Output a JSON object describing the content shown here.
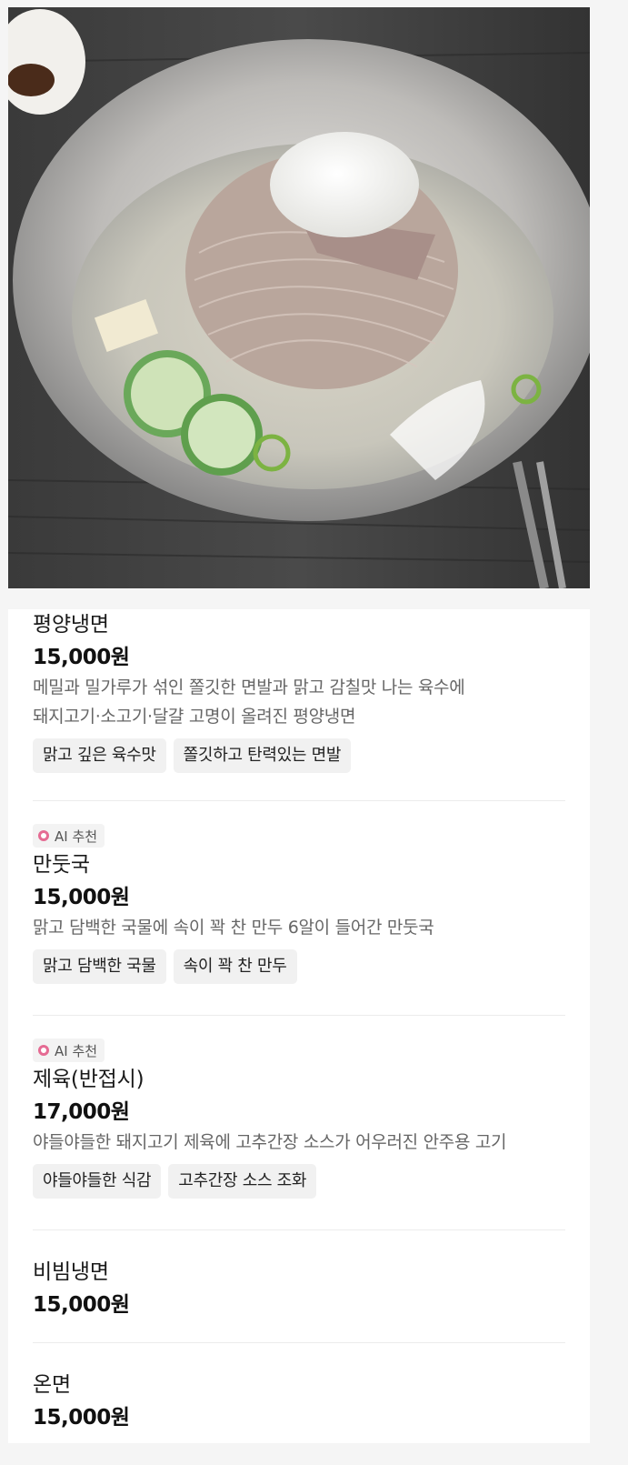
{
  "photo": {
    "subject": "naengmyeon-bowl-photo"
  },
  "badge_label": "AI 추천",
  "menu": [
    {
      "name": "평양냉면",
      "price": "15,000원",
      "desc_lines": [
        "메밀과 밀가루가 섞인 쫄깃한 면발과 맑고 감칠맛 나는 육수에",
        "돼지고기·소고기·달걀 고명이 올려진 평양냉면"
      ],
      "tags": [
        "맑고 깊은 육수맛",
        "쫄깃하고 탄력있는 면발"
      ],
      "ai": false
    },
    {
      "name": "만둣국",
      "price": "15,000원",
      "desc_lines": [
        "맑고 담백한 국물에 속이 꽉 찬 만두 6알이 들어간 만둣국"
      ],
      "tags": [
        "맑고 담백한 국물",
        "속이 꽉 찬 만두"
      ],
      "ai": true
    },
    {
      "name": "제육(반접시)",
      "price": "17,000원",
      "desc_lines": [
        "야들야들한 돼지고기 제육에 고추간장 소스가 어우러진 안주용 고기"
      ],
      "tags": [
        "야들야들한 식감",
        "고추간장 소스 조화"
      ],
      "ai": true
    },
    {
      "name": "비빔냉면",
      "price": "15,000원",
      "desc_lines": [],
      "tags": [],
      "ai": false
    },
    {
      "name": "온면",
      "price": "15,000원",
      "desc_lines": [],
      "tags": [],
      "ai": false
    }
  ],
  "colors": {
    "badge_ring": "#e56b93",
    "tag_bg": "#f1f1f1",
    "card_bg": "#ffffff",
    "page_bg": "#f5f5f5"
  }
}
